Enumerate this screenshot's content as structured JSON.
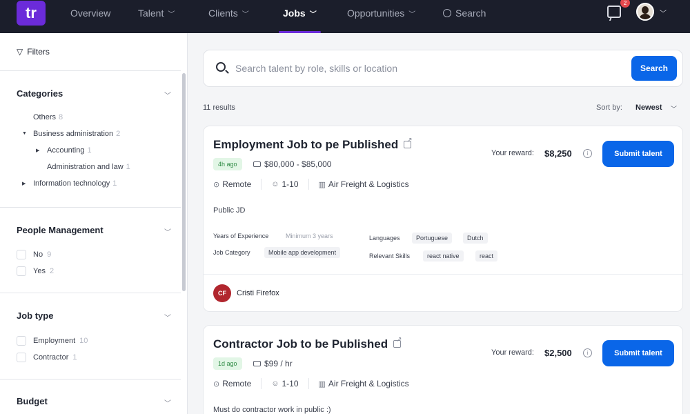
{
  "nav": {
    "logo_text": "tr",
    "items": [
      {
        "label": "Overview",
        "has_menu": false
      },
      {
        "label": "Talent",
        "has_menu": true
      },
      {
        "label": "Clients",
        "has_menu": true
      },
      {
        "label": "Jobs",
        "has_menu": true,
        "active": true
      },
      {
        "label": "Opportunities",
        "has_menu": true
      }
    ],
    "search_label": "Search",
    "notification_count": "2"
  },
  "sidebar": {
    "filters_label": "Filters",
    "categories": {
      "title": "Categories",
      "items": [
        {
          "label": "Others",
          "count": "8"
        },
        {
          "label": "Business administration",
          "count": "2"
        },
        {
          "label": "Accounting",
          "count": "1"
        },
        {
          "label": "Administration and law",
          "count": "1"
        },
        {
          "label": "Information technology",
          "count": "1"
        }
      ]
    },
    "people_management": {
      "title": "People Management",
      "options": [
        {
          "label": "No",
          "count": "9"
        },
        {
          "label": "Yes",
          "count": "2"
        }
      ]
    },
    "job_type": {
      "title": "Job type",
      "options": [
        {
          "label": "Employment",
          "count": "10"
        },
        {
          "label": "Contractor",
          "count": "1"
        }
      ]
    },
    "budget": {
      "title": "Budget"
    }
  },
  "search": {
    "placeholder": "Search talent by role, skills or location",
    "value": "",
    "button_label": "Search"
  },
  "results": {
    "count_text": "11 results",
    "sort_label": "Sort by:",
    "sort_value": "Newest"
  },
  "jobs": [
    {
      "title": "Employment Job to pe Published",
      "age": "4h ago",
      "salary": "$80,000 - $85,000",
      "location": "Remote",
      "team_size": "1-10",
      "industry": "Air Freight & Logistics",
      "reward_label": "Your reward:",
      "reward": "$8,250",
      "submit_label": "Submit talent",
      "description": "Public JD",
      "experience_label": "Years of Experience",
      "experience_value": "Minimum 3 years",
      "category_label": "Job Category",
      "category_value": "Mobile app development",
      "languages_label": "Languages",
      "languages": [
        "Portuguese",
        "Dutch"
      ],
      "skills_label": "Relevant Skills",
      "skills": [
        "react native",
        "react"
      ],
      "poster_initials": "CF",
      "poster_name": "Cristi Firefox"
    },
    {
      "title": "Contractor Job to be Published",
      "age": "1d ago",
      "salary": "$99 / hr",
      "location": "Remote",
      "team_size": "1-10",
      "industry": "Air Freight & Logistics",
      "reward_label": "Your reward:",
      "reward": "$2,500",
      "submit_label": "Submit talent",
      "description": "Must do contractor work in public :)"
    }
  ],
  "colors": {
    "nav_bg": "#1b1e2b",
    "brand_purple": "#6b2bd9",
    "primary_blue": "#0a66e8",
    "badge_green_bg": "#e2f6e6",
    "badge_green_text": "#2d8a43",
    "poster_red": "#b1262e"
  }
}
